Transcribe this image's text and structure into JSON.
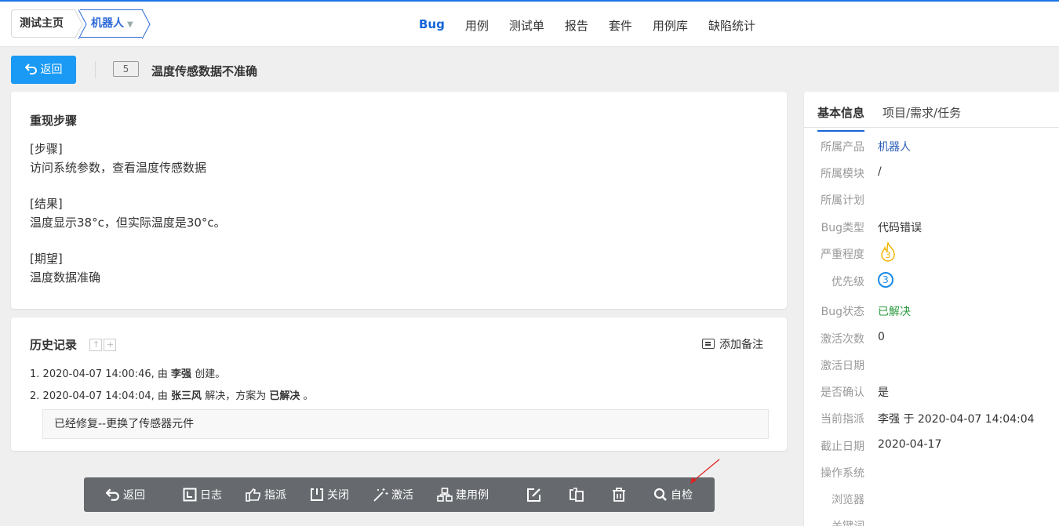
{
  "header": {
    "breadcrumb_home": "测试主页",
    "breadcrumb_product": "机器人",
    "nav": [
      "Bug",
      "用例",
      "测试单",
      "报告",
      "套件",
      "用例库",
      "缺陷统计"
    ],
    "nav_active": "Bug"
  },
  "page": {
    "back_label": "返回",
    "bug_id": "5",
    "bug_title": "温度传感数据不准确"
  },
  "steps": {
    "heading": "重现步骤",
    "lines": [
      "[步骤]",
      "访问系统参数，查看温度传感数据",
      "",
      "[结果]",
      "温度显示38°c，但实际温度是30°c。",
      "",
      "[期望]",
      "温度数据准确"
    ]
  },
  "history": {
    "heading": "历史记录",
    "add_note": "添加备注",
    "entries": [
      {
        "num": "1.",
        "time": "2020-04-07 14:00:46,",
        "by": "由",
        "user": "李强",
        "action": "创建。",
        "extra": "",
        "end": ""
      },
      {
        "num": "2.",
        "time": "2020-04-07 14:04:04,",
        "by": "由",
        "user": "张三风",
        "action": "解决，方案为",
        "extra": "已解决",
        "end": "。"
      }
    ],
    "comment": "已经修复--更换了传感器元件"
  },
  "side": {
    "tabs": [
      "基本信息",
      "项目/需求/任务"
    ],
    "rows": [
      {
        "label": "所属产品",
        "value": "机器人"
      },
      {
        "label": "所属模块",
        "value": "/"
      },
      {
        "label": "所属计划",
        "value": ""
      },
      {
        "label": "Bug类型",
        "value": "代码错误"
      },
      {
        "label": "严重程度",
        "value": "3"
      },
      {
        "label": "优先级",
        "value": "3"
      },
      {
        "label": "Bug状态",
        "value": "已解决"
      },
      {
        "label": "激活次数",
        "value": "0"
      },
      {
        "label": "激活日期",
        "value": ""
      },
      {
        "label": "是否确认",
        "value": "是"
      },
      {
        "label": "当前指派",
        "value": "李强 于 2020-04-07 14:04:04"
      },
      {
        "label": "截止日期",
        "value": "2020-04-17"
      },
      {
        "label": "操作系统",
        "value": ""
      },
      {
        "label": "浏览器",
        "value": ""
      },
      {
        "label": "关键词",
        "value": ""
      }
    ]
  },
  "toolbar": {
    "back": "返回",
    "log": "日志",
    "assign": "指派",
    "close": "关闭",
    "activate": "激活",
    "create_case": "建用例",
    "self_check": "自检"
  },
  "colors": {
    "accent": "#1a9af5",
    "nav_active": "#1565d8",
    "status_resolved": "#2a9a3e",
    "toolbar_bg": "#666a6e"
  }
}
